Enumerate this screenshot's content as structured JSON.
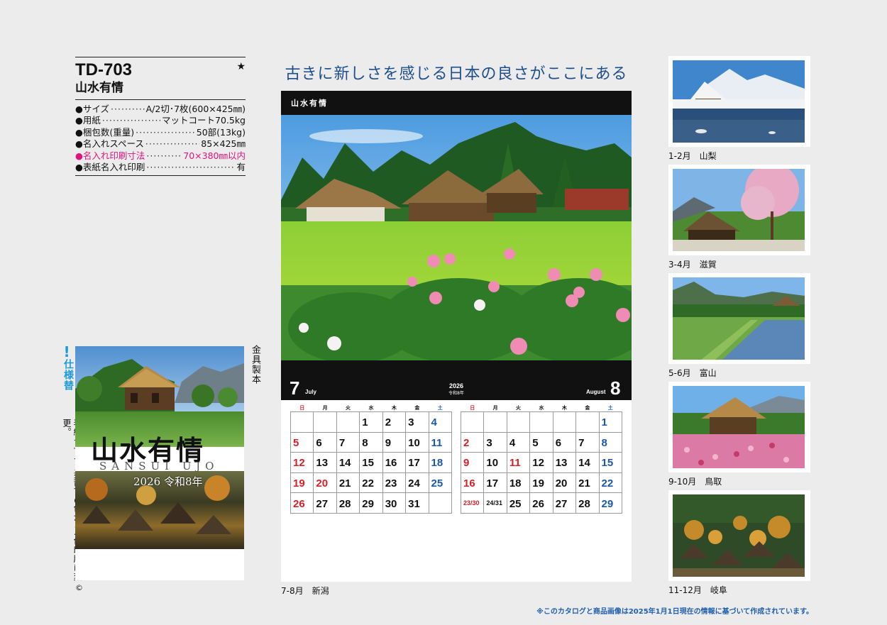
{
  "product": {
    "code": "TD-703",
    "star": "★",
    "name": "山水有情"
  },
  "specs": [
    {
      "label": "●サイズ",
      "value": "A/2切･7枚(600×425㎜)",
      "highlight": false
    },
    {
      "label": "●用紙",
      "value": "マットコート70.5kg",
      "highlight": false
    },
    {
      "label": "●梱包数(重量)",
      "value": "50部(13kg)",
      "highlight": false
    },
    {
      "label": "●名入れスペース",
      "value": "85×425㎜",
      "highlight": false
    },
    {
      "label": "●名入れ印刷寸法",
      "value": "70×380㎜以内",
      "highlight": true
    },
    {
      "label": "●表紙名入れ印刷",
      "value": "有",
      "highlight": false
    }
  ],
  "cover": {
    "title": "山水有情",
    "romaji": "SANSUI UJO",
    "year": "2026 令和8年",
    "binding": "金具製本",
    "copyright": "©"
  },
  "change_note": {
    "mark": "!",
    "title": "仕様替",
    "body": "表紙デザイン変更、5色から4色印刷に変更。"
  },
  "catchphrase": "古きに新しさを感じる日本の良さがここにある",
  "sheet": {
    "brand": "山水有情",
    "left_month_num": "7",
    "left_month_name": "July",
    "right_month_num": "8",
    "right_month_name": "August",
    "year": "2026",
    "era": "令和8年",
    "caption": "7-8月　新潟"
  },
  "weekdays": [
    "日",
    "月",
    "火",
    "水",
    "木",
    "金",
    "土"
  ],
  "colors": {
    "sunday": "#d81f26",
    "saturday": "#1a57b0",
    "pink_spec": "#e2117e",
    "catch_blue": "#1f4e8c",
    "change_blue": "#1d9bd8"
  },
  "july_weeks": [
    [
      "",
      "",
      "",
      "1",
      "2",
      "3",
      "4"
    ],
    [
      "5",
      "6",
      "7",
      "8",
      "9",
      "10",
      "11"
    ],
    [
      "12",
      "13",
      "14",
      "15",
      "16",
      "17",
      "18"
    ],
    [
      "19",
      "20",
      "21",
      "22",
      "23",
      "24",
      "25"
    ],
    [
      "26",
      "27",
      "28",
      "29",
      "30",
      "31",
      ""
    ]
  ],
  "july_holidays": [
    "20"
  ],
  "august_weeks": [
    [
      "",
      "",
      "",
      "",
      "",
      "",
      "1"
    ],
    [
      "2",
      "3",
      "4",
      "5",
      "6",
      "7",
      "8"
    ],
    [
      "9",
      "10",
      "11",
      "12",
      "13",
      "14",
      "15"
    ],
    [
      "16",
      "17",
      "18",
      "19",
      "20",
      "21",
      "22"
    ],
    [
      "23/30",
      "24/31",
      "25",
      "26",
      "27",
      "28",
      "29"
    ]
  ],
  "august_holidays": [
    "11"
  ],
  "thumbnails": [
    {
      "caption": "1-2月　山梨",
      "scene": "snow-lake"
    },
    {
      "caption": "3-4月　滋賀",
      "scene": "cherry-house"
    },
    {
      "caption": "5-6月　富山",
      "scene": "rice-paddy"
    },
    {
      "caption": "9-10月　鳥取",
      "scene": "cosmos-house"
    },
    {
      "caption": "11-12月　岐阜",
      "scene": "autumn-village"
    }
  ],
  "footnote": "※このカタログと商品画像は2025年1月1日現在の情報に基づいて作成されています。"
}
